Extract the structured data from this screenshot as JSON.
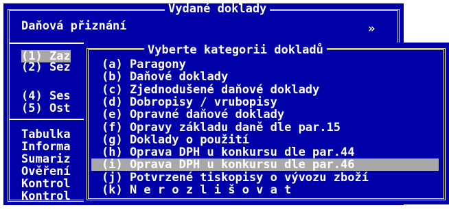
{
  "outer_window": {
    "title": "Vydané doklady",
    "header_text": "Daňová přiznání",
    "header_arrow": "»",
    "items_top": [
      "(1) Zaz",
      "(2) Sez"
    ],
    "items_mid": [
      "(4) Ses",
      "(5) Ost"
    ],
    "items_bottom": [
      "Tabulka",
      "Informa",
      "Sumariz",
      "Ověření",
      "Kontrol",
      "Kontrol"
    ]
  },
  "category_dialog": {
    "title": "Vyberte kategorii dokladů",
    "items": [
      "(a) Paragony",
      "(b) Daňové doklady",
      "(c) Zjednodušené daňové doklady",
      "(d) Dobropisy / vrubopisy",
      "(e) Opravné daňové doklady",
      "(f) Opravy základu daně dle par.15",
      "(g) Doklady o použití",
      "(h) Oprava DPH u konkursu dle par.44",
      "(i) Oprava DPH u konkursu dle par.46",
      "(j) Potvrzené tiskopisy o vývozu zboží",
      "(k) N e r o z l i š o v a t"
    ],
    "selected_index": 8
  },
  "colors": {
    "background": "#0000a8",
    "text": "#ffffff",
    "highlight": "#a8a8a8",
    "screen": "#ffffff"
  }
}
